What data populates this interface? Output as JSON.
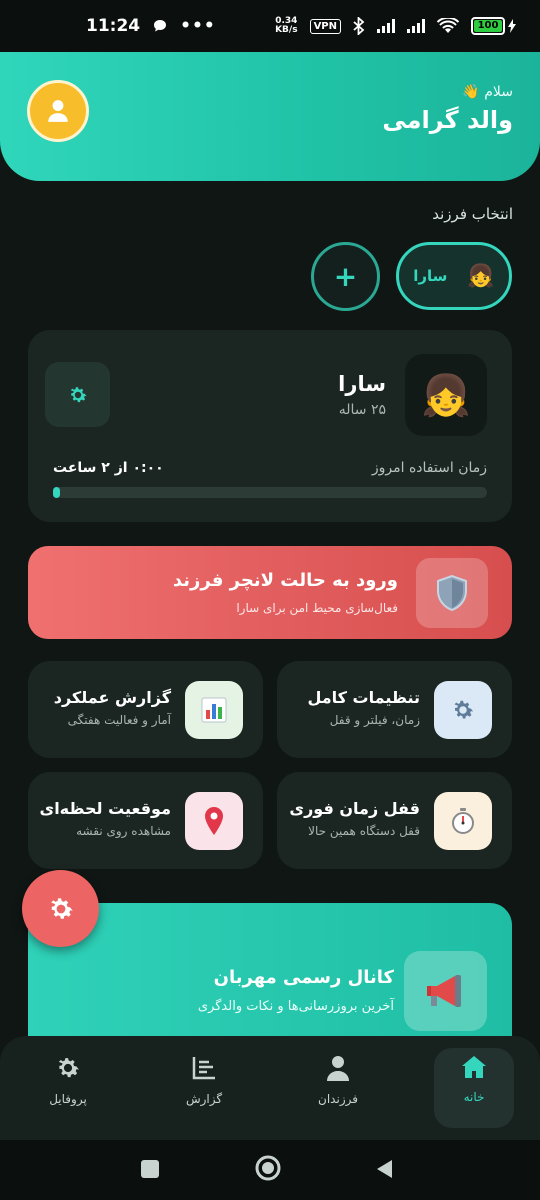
{
  "status_bar": {
    "time": "11:24",
    "net_speed_value": "0.34",
    "net_speed_unit": "KB/s",
    "vpn_label": "VPN",
    "battery_level": "100",
    "battery_fraction": 1.0
  },
  "header": {
    "greeting_small": "سلام 👋",
    "greeting_name": "والد گرامی"
  },
  "children_section": {
    "title": "انتخاب فرزند",
    "selected_child": {
      "name": "سارا",
      "emoji": "👧"
    },
    "add_label": "+"
  },
  "child_card": {
    "emoji": "👧",
    "name": "سارا",
    "age": "۲۵ ساله",
    "usage_label": "زمان استفاده امروز",
    "usage_value": "۰:۰۰ از ۲ ساعت",
    "usage_fraction": 0.0
  },
  "launcher_banner": {
    "title": "ورود به حالت لانچر فرزند",
    "subtitle": "فعال‌سازی محیط امن برای سارا"
  },
  "tiles": [
    {
      "title": "تنظیمات کامل",
      "subtitle": "زمان، فیلتر و قفل",
      "icon": "gear-icon",
      "icon_bg": "#dbe9f7"
    },
    {
      "title": "گزارش عملکرد",
      "subtitle": "آمار و فعالیت هفتگی",
      "icon": "bar-chart-icon",
      "icon_bg": "#e4f3e4"
    },
    {
      "title": "قفل زمان فوری",
      "subtitle": "قفل دستگاه همین حالا",
      "icon": "stopwatch-icon",
      "icon_bg": "#fbf0de"
    },
    {
      "title": "موقعیت لحظه‌ای",
      "subtitle": "مشاهده روی نقشه",
      "icon": "location-pin-icon",
      "icon_bg": "#fbe3ea"
    }
  ],
  "channel_banner": {
    "title": "کانال رسمی مهربان",
    "subtitle": "آخرین بروزرسانی‌ها و نکات والدگری"
  },
  "bottom_nav": {
    "home": "خانه",
    "children": "فرزندان",
    "report": "گزارش",
    "profile": "پروفایل"
  },
  "colors": {
    "accent": "#35d6be",
    "danger": "#ec6464",
    "background": "#0f1614",
    "card": "#1b2622"
  }
}
